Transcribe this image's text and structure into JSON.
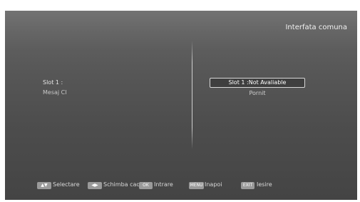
{
  "header": {
    "title": "Interfata comuna"
  },
  "left": {
    "slot_label": "Slot 1 :",
    "message_label": "Mesaj CI"
  },
  "right": {
    "slot_value": "Slot 1 :Not Avaliable",
    "message_value": "Pornit"
  },
  "footer": {
    "select_label": "Selectare",
    "switch_label": "Schimba cadru",
    "ok_key": "OK",
    "enter_label": "Intrare",
    "menu_key": "MENU",
    "back_label": "Inapoi",
    "exit_key": "EXIT",
    "exit_label": "Iesire"
  }
}
